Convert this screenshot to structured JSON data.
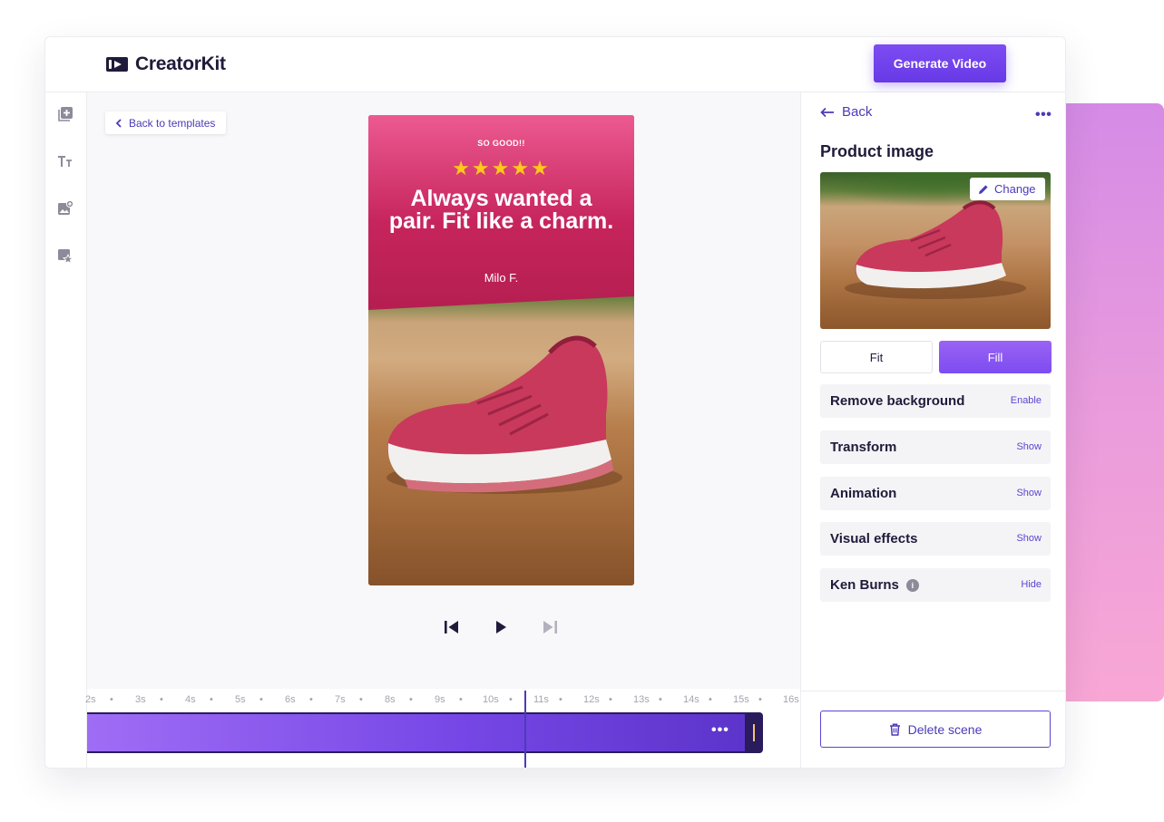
{
  "app": {
    "name": "CreatorKit",
    "accent": "#6739e6",
    "icon": "logo-play-icon"
  },
  "topbar": {
    "generate_label": "Generate Video"
  },
  "leftbar": {
    "icons": [
      "add-layer-icon",
      "text-icon",
      "add-image-icon",
      "sticker-icon"
    ]
  },
  "canvas": {
    "back_to_templates": "Back to templates",
    "scene": {
      "tag": "SO GOOD!!",
      "stars": "★★★★★",
      "rating": 5,
      "quote": "Always wanted a pair. Fit like a charm.",
      "author": "Milo F."
    }
  },
  "controls": [
    "skip-back-icon",
    "play-icon",
    "skip-forward-icon"
  ],
  "timeline": {
    "ticks": [
      "2s",
      "3s",
      "4s",
      "5s",
      "6s",
      "7s",
      "8s",
      "9s",
      "10s",
      "11s",
      "12s",
      "13s",
      "14s",
      "15s",
      "16s"
    ],
    "separator": "•",
    "clip_menu": "•••"
  },
  "panel": {
    "back_label": "Back",
    "more": "•••",
    "title": "Product image",
    "change_label": "Change",
    "fit_label": "Fit",
    "fill_label": "Fill",
    "sections": [
      {
        "label": "Remove background",
        "action": "Enable"
      },
      {
        "label": "Transform",
        "action": "Show"
      },
      {
        "label": "Animation",
        "action": "Show"
      },
      {
        "label": "Visual effects",
        "action": "Show"
      },
      {
        "label": "Ken Burns",
        "action": "Hide",
        "info": "i"
      }
    ],
    "delete_label": "Delete scene"
  }
}
